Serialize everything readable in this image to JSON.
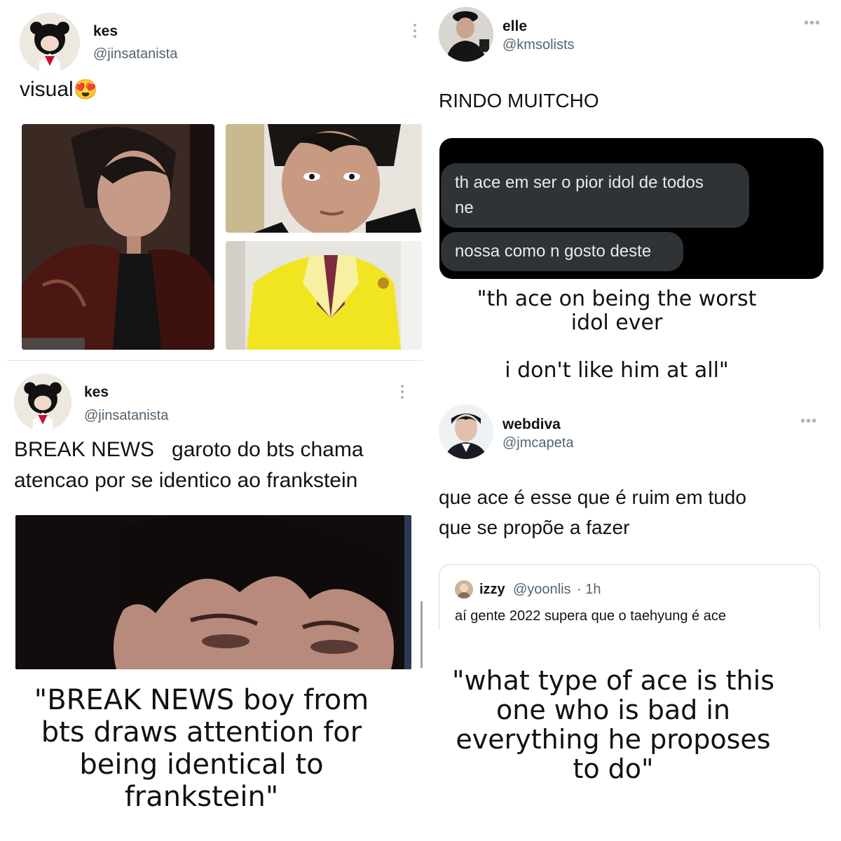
{
  "tweets": [
    {
      "name": "kes",
      "handle": "@jinsatanista",
      "text": "visual",
      "emoji": "😍"
    },
    {
      "name": "elle",
      "handle": "@kmsolists",
      "text": "RINDO MUITCHO",
      "chat": [
        {
          "text": "th ace em ser o pior idol de todos\nne"
        },
        {
          "text": "nossa como n gosto deste"
        }
      ],
      "caption": "\"th ace on being the worst\nidol ever\n\ni don't like him at all\""
    },
    {
      "name": "kes",
      "handle": "@jinsatanista",
      "text_line1": "BREAK NEWS   garoto do bts chama",
      "text_line2": "atencao por se identico ao frankstein",
      "caption": "\"BREAK NEWS boy from\nbts draws attention for\nbeing identical to\nfrankstein\""
    },
    {
      "name": "webdiva",
      "handle": "@jmcapeta",
      "text_line1": "que ace é esse que é ruim em tudo",
      "text_line2": "que se propõe a fazer",
      "quote": {
        "name": "izzy",
        "handle": "@yoonlis",
        "time": "· 1h",
        "text": "aí gente 2022 supera que o taehyung é ace"
      },
      "caption": "\"what type of ace is this\none who is bad in\neverything he proposes\nto do\""
    }
  ],
  "colors": {
    "text": "#0f1419",
    "secondary": "#536471",
    "chat_bg": "#000000",
    "bubble_bg": "#2f3336",
    "bubble_text": "#e7e9ea"
  }
}
